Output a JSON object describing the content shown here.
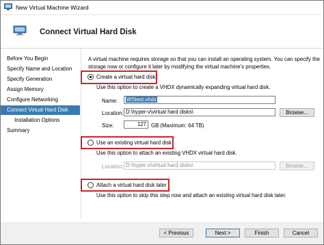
{
  "window": {
    "title": "New Virtual Machine Wizard"
  },
  "header": {
    "title": "Connect Virtual Hard Disk"
  },
  "nav": {
    "items": [
      {
        "label": "Before You Begin"
      },
      {
        "label": "Specify Name and Location"
      },
      {
        "label": "Specify Generation"
      },
      {
        "label": "Assign Memory"
      },
      {
        "label": "Configure Networking"
      },
      {
        "label": "Connect Virtual Hard Disk"
      },
      {
        "label": "Installation Options"
      },
      {
        "label": "Summary"
      }
    ]
  },
  "main": {
    "description": "A virtual machine requires storage so that you can install an operating system. You can specify the storage now or configure it later by modifying the virtual machine's properties.",
    "create": {
      "label": "Create a virtual hard disk",
      "description": "Use this option to create a VHDX dynamically expanding virtual hard disk.",
      "name_label": "Name:",
      "name_value": "WStest.vhdx",
      "location_label": "Location:",
      "location_value": "D:\\hyper-v\\virtual hard disks\\",
      "browse_label": "Browse...",
      "size_label": "Size:",
      "size_value": "127",
      "size_unit": "GB (Maximum: 64 TB)"
    },
    "existing": {
      "label": "Use an existing virtual hard disk",
      "description": "Use this option to attach an existing VHDX virtual hard disk.",
      "location_label": "Location:",
      "location_value": "D:\\hyper-v\\virtual hard disks\\",
      "browse_label": "Browse..."
    },
    "later": {
      "label": "Attach a virtual hard disk later",
      "description": "Use this option to skip this step now and attach an existing virtual hard disk later."
    }
  },
  "footer": {
    "previous_label": "< Previous",
    "next_label": "Next >",
    "finish_label": "Finish",
    "cancel_label": "Cancel"
  },
  "colors": {
    "accent": "#3d7ab3",
    "highlight_border": "#c8232c"
  }
}
